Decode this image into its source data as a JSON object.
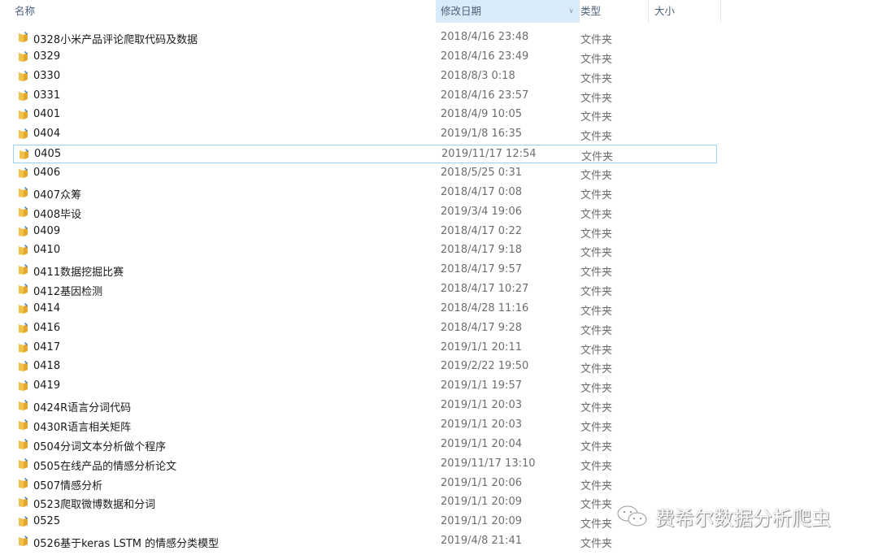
{
  "header": {
    "name": "名称",
    "date": "修改日期",
    "type": "类型",
    "size": "大小"
  },
  "selected_index": 6,
  "accent": "#99d1ff",
  "rows": [
    {
      "name": "0328小米产品评论爬取代码及数据",
      "date": "2018/4/16 23:48",
      "type": "文件夹"
    },
    {
      "name": "0329",
      "date": "2018/4/16 23:49",
      "type": "文件夹"
    },
    {
      "name": "0330",
      "date": "2018/8/3 0:18",
      "type": "文件夹"
    },
    {
      "name": "0331",
      "date": "2018/4/16 23:57",
      "type": "文件夹"
    },
    {
      "name": "0401",
      "date": "2018/4/9 10:05",
      "type": "文件夹"
    },
    {
      "name": "0404",
      "date": "2019/1/8 16:35",
      "type": "文件夹"
    },
    {
      "name": "0405",
      "date": "2019/11/17 12:54",
      "type": "文件夹"
    },
    {
      "name": "0406",
      "date": "2018/5/25 0:31",
      "type": "文件夹"
    },
    {
      "name": "0407众筹",
      "date": "2018/4/17 0:08",
      "type": "文件夹"
    },
    {
      "name": "0408毕设",
      "date": "2019/3/4 19:06",
      "type": "文件夹"
    },
    {
      "name": "0409",
      "date": "2018/4/17 0:22",
      "type": "文件夹"
    },
    {
      "name": "0410",
      "date": "2018/4/17 9:18",
      "type": "文件夹"
    },
    {
      "name": "0411数据挖掘比赛",
      "date": "2018/4/17 9:57",
      "type": "文件夹"
    },
    {
      "name": "0412基因检测",
      "date": "2018/4/17 10:27",
      "type": "文件夹"
    },
    {
      "name": "0414",
      "date": "2018/4/28 11:16",
      "type": "文件夹"
    },
    {
      "name": "0416",
      "date": "2018/4/17 9:28",
      "type": "文件夹"
    },
    {
      "name": "0417",
      "date": "2019/1/1 20:11",
      "type": "文件夹"
    },
    {
      "name": "0418",
      "date": "2019/2/22 19:50",
      "type": "文件夹"
    },
    {
      "name": "0419",
      "date": "2019/1/1 19:57",
      "type": "文件夹"
    },
    {
      "name": "0424R语言分词代码",
      "date": "2019/1/1 20:03",
      "type": "文件夹"
    },
    {
      "name": "0430R语言相关矩阵",
      "date": "2019/1/1 20:03",
      "type": "文件夹"
    },
    {
      "name": "0504分词文本分析做个程序",
      "date": "2019/1/1 20:04",
      "type": "文件夹"
    },
    {
      "name": "0505在线产品的情感分析论文",
      "date": "2019/11/17 13:10",
      "type": "文件夹"
    },
    {
      "name": "0507情感分析",
      "date": "2019/1/1 20:06",
      "type": "文件夹"
    },
    {
      "name": "0523爬取微博数据和分词",
      "date": "2019/1/1 20:09",
      "type": "文件夹"
    },
    {
      "name": "0525",
      "date": "2019/1/1 20:09",
      "type": "文件夹"
    },
    {
      "name": "0526基于keras LSTM 的情感分类模型",
      "date": "2019/4/8 21:41",
      "type": "文件夹"
    }
  ],
  "watermark": "费希尔数据分析爬虫"
}
